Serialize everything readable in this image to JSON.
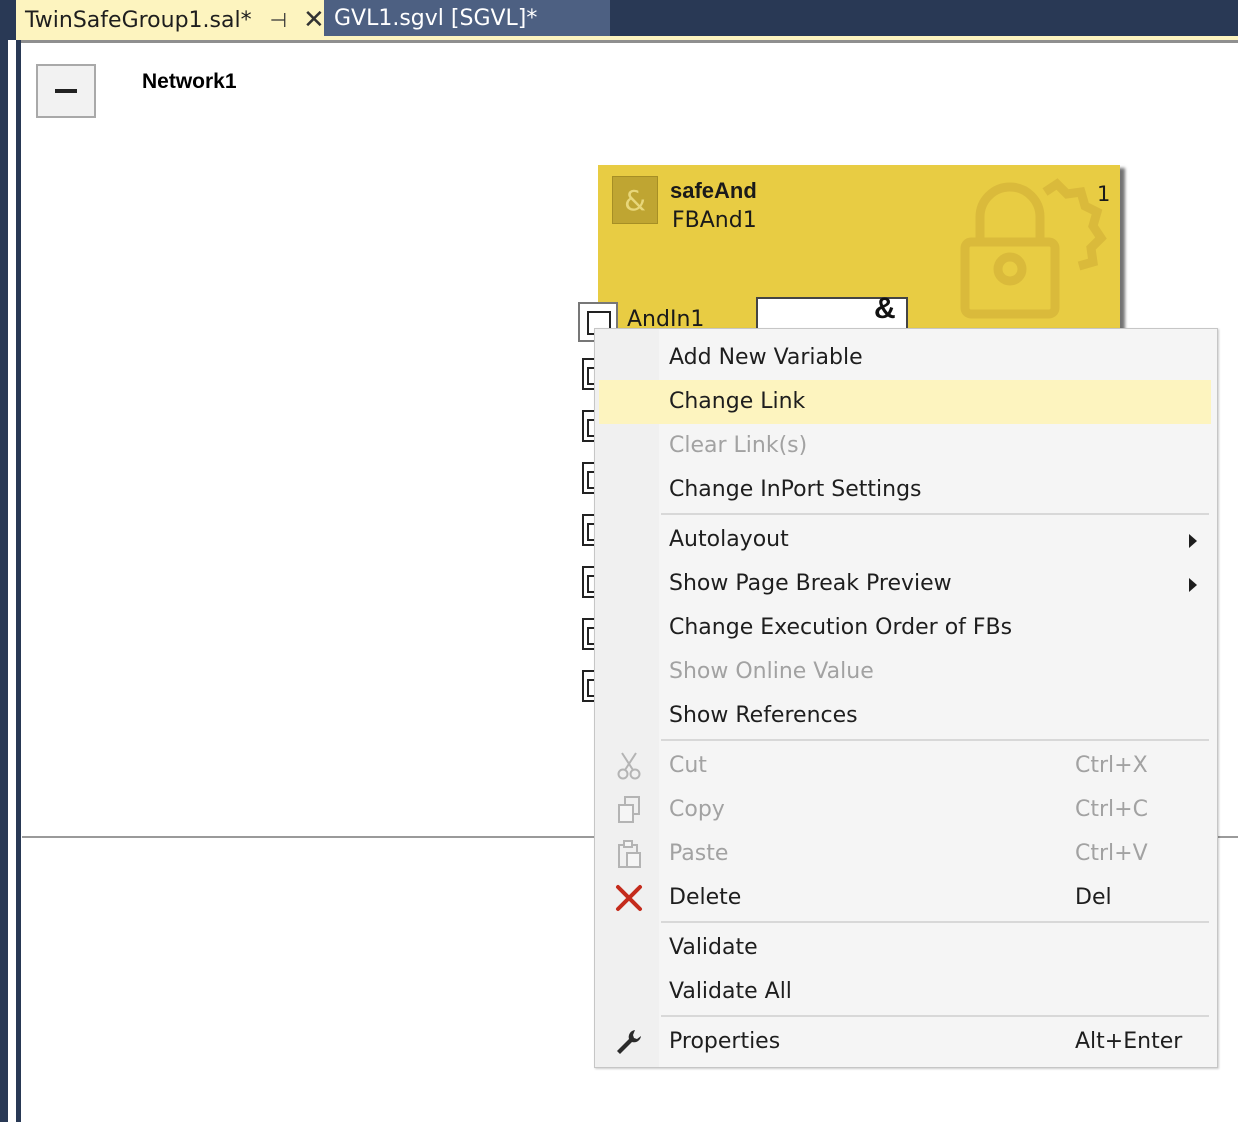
{
  "tabs": [
    {
      "label": "TwinSafeGroup1.sal*",
      "active": true
    },
    {
      "label": "GVL1.sgvl [SGVL]*",
      "active": false
    }
  ],
  "icons": {
    "pin": "pin-icon",
    "close": "close-icon",
    "collapse": "collapse-icon",
    "and_block": "and-block-icon",
    "watermark": "safety-lock-gear-icon",
    "cut": "scissors-icon",
    "copy": "copy-icon",
    "paste": "paste-icon",
    "delete": "red-x-icon",
    "properties": "wrench-icon",
    "port": "port-connector-icon",
    "submenu": "submenu-arrow-icon"
  },
  "network": {
    "title": "Network1"
  },
  "function_block": {
    "type": "safeAnd",
    "instance": "FBAnd1",
    "execution_order": "1",
    "operator": "&",
    "first_port": "AndIn1",
    "port_count": 8
  },
  "context_menu": {
    "hover_item": "Change Link",
    "items": [
      {
        "label": "Add New Variable"
      },
      {
        "label": "Change Link",
        "highlighted": true
      },
      {
        "label": "Clear Link(s)",
        "disabled": true
      },
      {
        "label": "Change InPort Settings"
      },
      {
        "label": "Autolayout",
        "submenu": true
      },
      {
        "label": "Show Page Break Preview",
        "submenu": true
      },
      {
        "label": "Change Execution Order of FBs"
      },
      {
        "label": "Show Online Value",
        "disabled": true
      },
      {
        "label": "Show References"
      },
      {
        "label": "Cut",
        "shortcut": "Ctrl+X",
        "disabled": true
      },
      {
        "label": "Copy",
        "shortcut": "Ctrl+C",
        "disabled": true
      },
      {
        "label": "Paste",
        "shortcut": "Ctrl+V",
        "disabled": true
      },
      {
        "label": "Delete",
        "shortcut": "Del"
      },
      {
        "label": "Validate"
      },
      {
        "label": "Validate All"
      },
      {
        "label": "Properties",
        "shortcut": "Alt+Enter"
      }
    ]
  },
  "colors": {
    "frame": "#293955",
    "active_tab": "#fdf4bf",
    "inactive_tab": "#4d6082",
    "function_block": "#e8cc43",
    "menu_hover": "#fdf4bf",
    "delete_icon": "#c42b1c"
  }
}
